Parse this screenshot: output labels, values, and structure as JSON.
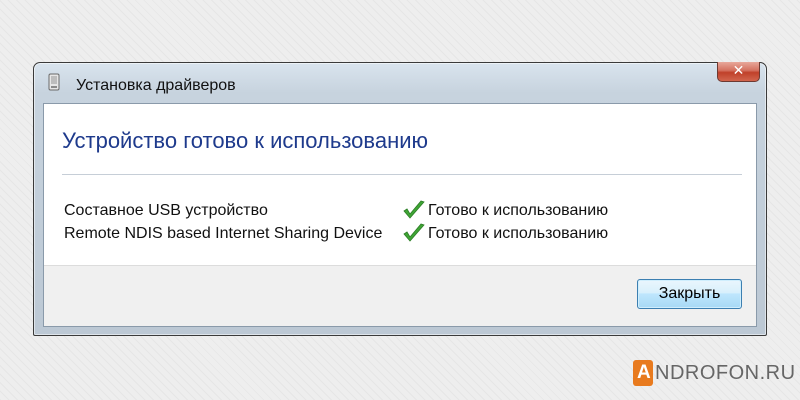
{
  "window": {
    "title": "Установка драйверов",
    "close_label": "✕"
  },
  "content": {
    "heading": "Устройство готово к использованию",
    "devices": [
      {
        "name": "Составное USB устройство",
        "status": "Готово к использованию",
        "status_icon": "green-check-icon"
      },
      {
        "name": "Remote NDIS based Internet Sharing Device",
        "status": "Готово к использованию",
        "status_icon": "green-check-icon"
      }
    ]
  },
  "footer": {
    "close_button_label": "Закрыть"
  },
  "watermark": {
    "mark_letter": "A",
    "text": "NDROFON.RU"
  },
  "colors": {
    "heading": "#1e3a8c",
    "check": "#3fa535",
    "watermark_accent": "#e87a1e"
  }
}
